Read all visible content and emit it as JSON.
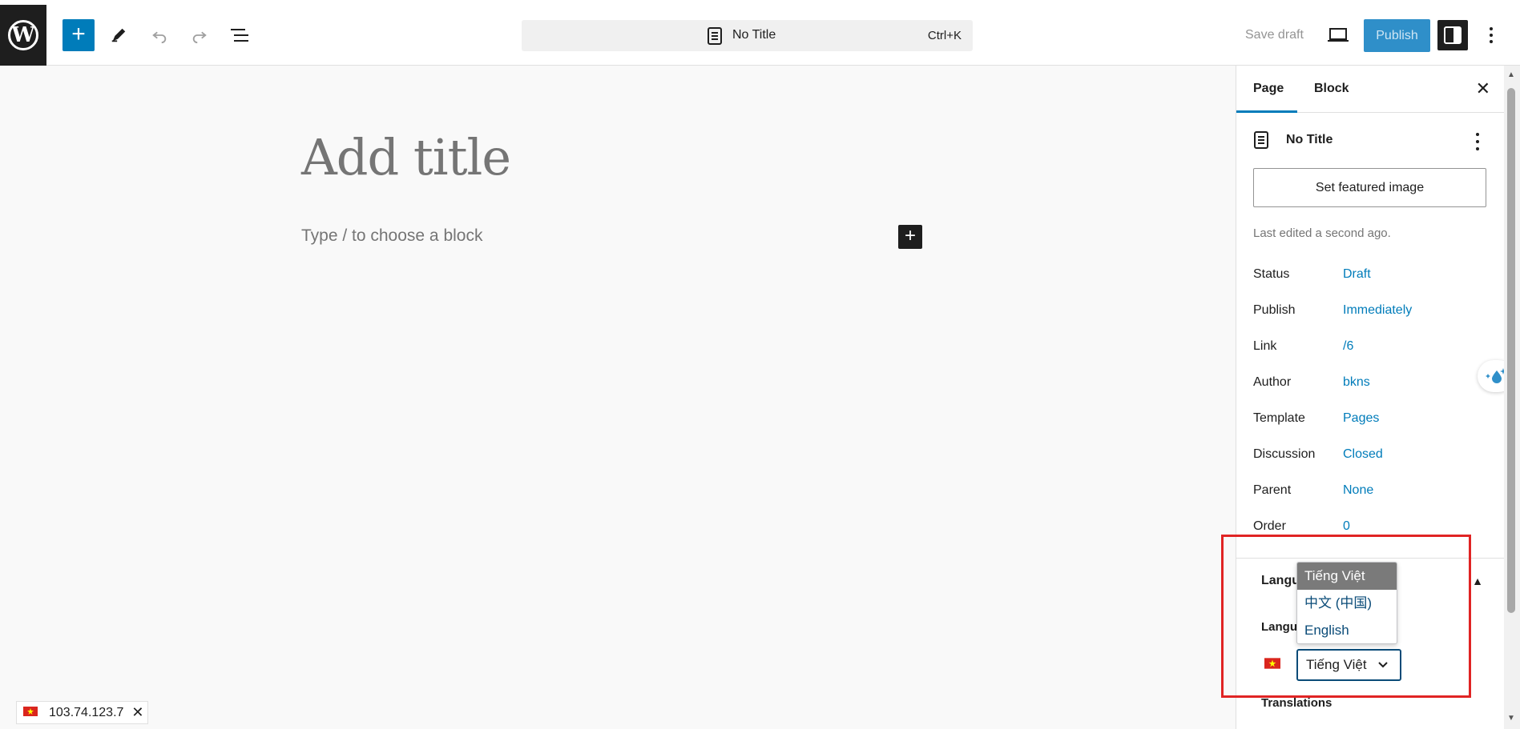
{
  "header": {
    "logo_letter": "W",
    "add_label": "+",
    "command_title": "No Title",
    "command_shortcut": "Ctrl+K",
    "save_draft": "Save draft",
    "publish": "Publish"
  },
  "editor": {
    "title_placeholder": "Add title",
    "block_placeholder": "Type / to choose a block",
    "inserter_label": "+"
  },
  "ip_badge": {
    "ip": "103.74.123.7",
    "close": "✕"
  },
  "sidebar": {
    "tabs": [
      {
        "label": "Page",
        "active": true
      },
      {
        "label": "Block",
        "active": false
      }
    ],
    "close": "✕",
    "doc_title": "No Title",
    "featured_image": "Set featured image",
    "last_edited": "Last edited a second ago.",
    "meta": [
      {
        "key": "Status",
        "value": "Draft"
      },
      {
        "key": "Publish",
        "value": "Immediately"
      },
      {
        "key": "Link",
        "value": "/6"
      },
      {
        "key": "Author",
        "value": "bkns"
      },
      {
        "key": "Template",
        "value": "Pages"
      },
      {
        "key": "Discussion",
        "value": "Closed"
      },
      {
        "key": "Parent",
        "value": "None"
      },
      {
        "key": "Order",
        "value": "0"
      }
    ],
    "language_heading": "Langu",
    "language_label": "Langu",
    "language_selected": "Tiếng Việt",
    "translations_label": "Translations",
    "collapse_arrow": "▲"
  },
  "language_dropdown": {
    "options": [
      "Tiếng Việt",
      "中文 (中国)",
      "English"
    ],
    "selected_index": 0
  },
  "colors": {
    "accent": "#007cba",
    "highlight": "#e02424"
  }
}
